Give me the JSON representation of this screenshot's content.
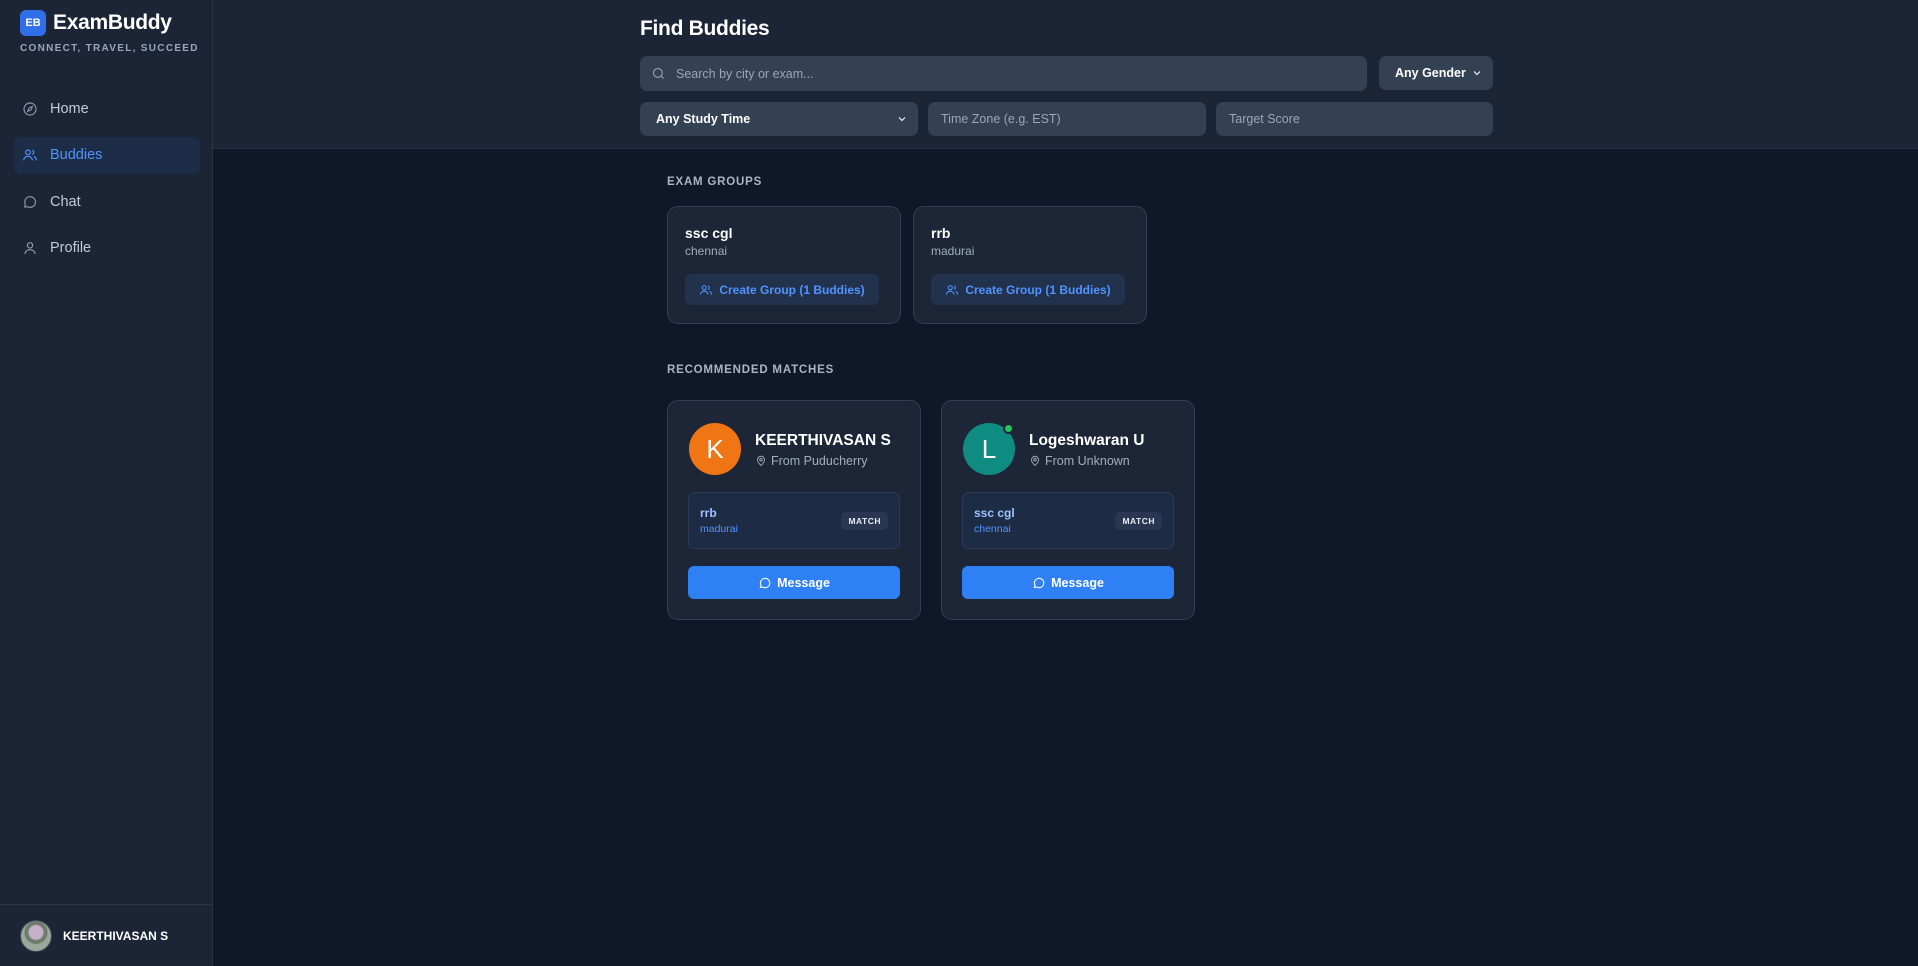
{
  "app": {
    "badge": "EB",
    "name": "ExamBuddy",
    "tagline": "CONNECT, TRAVEL, SUCCEED"
  },
  "nav": {
    "items": [
      {
        "label": "Home",
        "icon": "compass-icon"
      },
      {
        "label": "Buddies",
        "icon": "users-icon",
        "active": true
      },
      {
        "label": "Chat",
        "icon": "chat-bubble-icon"
      },
      {
        "label": "Profile",
        "icon": "user-icon"
      }
    ]
  },
  "user": {
    "name": "KEERTHIVASAN S"
  },
  "header": {
    "title": "Find Buddies",
    "search_placeholder": "Search by city or exam...",
    "gender_select": "Any Gender",
    "study_time_select": "Any Study Time",
    "timezone_placeholder": "Time Zone (e.g. EST)",
    "target_score_placeholder": "Target Score"
  },
  "exam_groups": {
    "label": "EXAM GROUPS",
    "groups": [
      {
        "exam": "ssc cgl",
        "city": "chennai",
        "button": "Create Group (1 Buddies)"
      },
      {
        "exam": "rrb",
        "city": "madurai",
        "button": "Create Group (1 Buddies)"
      }
    ]
  },
  "matches": {
    "label": "RECOMMENDED MATCHES",
    "items": [
      {
        "initial": "K",
        "name": "KEERTHIVASAN S",
        "from": "From Puducherry",
        "exam": "rrb",
        "city": "madurai",
        "badge": "MATCH",
        "button": "Message",
        "avatar_color": "#f07515",
        "online": false
      },
      {
        "initial": "L",
        "name": "Logeshwaran U",
        "from": "From Unknown",
        "exam": "ssc cgl",
        "city": "chennai",
        "badge": "MATCH",
        "button": "Message",
        "avatar_color": "#0f8c82",
        "online": true
      }
    ]
  },
  "colors": {
    "accent": "#2f80f5",
    "background": "#0f1828",
    "panel": "#1b2535",
    "online": "#22c55e"
  }
}
